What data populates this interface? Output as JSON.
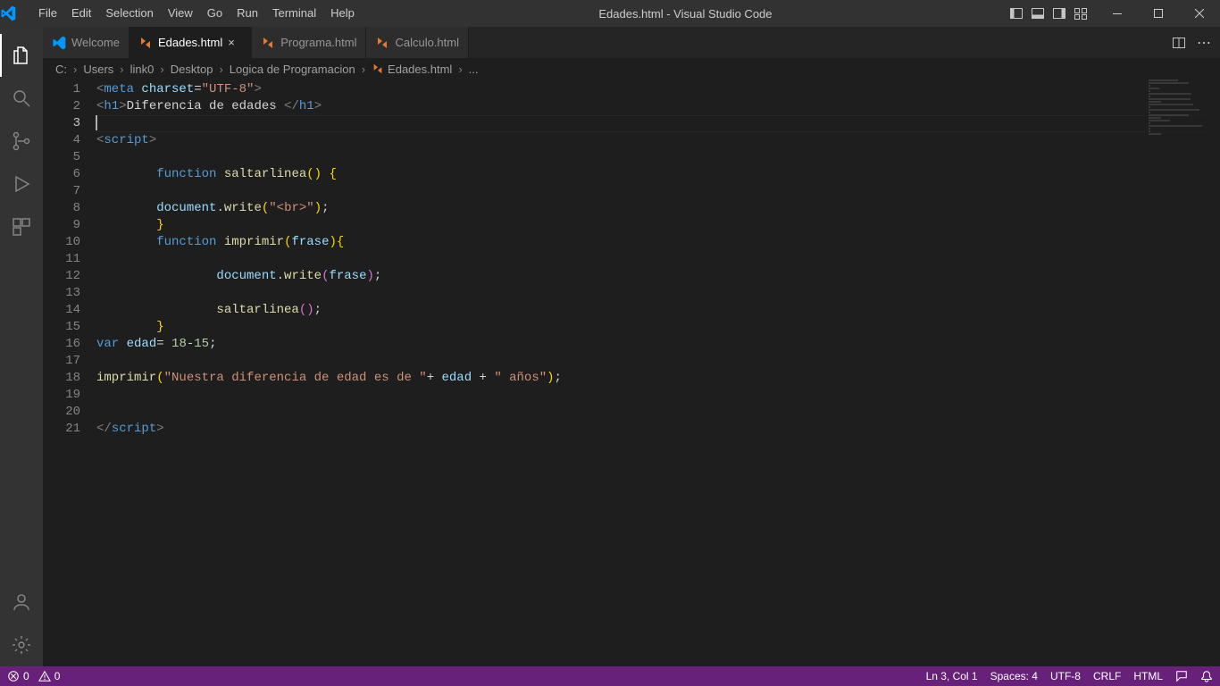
{
  "window": {
    "title": "Edades.html - Visual Studio Code"
  },
  "menu": [
    "File",
    "Edit",
    "Selection",
    "View",
    "Go",
    "Run",
    "Terminal",
    "Help"
  ],
  "tabs": [
    {
      "label": "Welcome",
      "icon": "vscode",
      "active": false
    },
    {
      "label": "Edades.html",
      "icon": "html",
      "active": true
    },
    {
      "label": "Programa.html",
      "icon": "html",
      "active": false
    },
    {
      "label": "Calculo.html",
      "icon": "html",
      "active": false
    }
  ],
  "breadcrumbs": {
    "segments": [
      "C:",
      "Users",
      "link0",
      "Desktop",
      "Logica de Programacion"
    ],
    "file": "Edades.html",
    "tail": "..."
  },
  "editor": {
    "line_count": 21,
    "active_line": 3,
    "lines": [
      {
        "tokens": [
          {
            "c": "c-punc",
            "t": "<"
          },
          {
            "c": "c-tag",
            "t": "meta"
          },
          {
            "c": "",
            "t": " "
          },
          {
            "c": "c-attr",
            "t": "charset"
          },
          {
            "c": "c-delim",
            "t": "="
          },
          {
            "c": "c-str",
            "t": "\"UTF-8\""
          },
          {
            "c": "c-punc",
            "t": ">"
          }
        ]
      },
      {
        "tokens": [
          {
            "c": "c-punc",
            "t": "<"
          },
          {
            "c": "c-tag",
            "t": "h1"
          },
          {
            "c": "c-punc",
            "t": ">"
          },
          {
            "c": "c-text",
            "t": "Diferencia de edades "
          },
          {
            "c": "c-punc",
            "t": "</"
          },
          {
            "c": "c-tag",
            "t": "h1"
          },
          {
            "c": "c-punc",
            "t": ">"
          }
        ]
      },
      {
        "tokens": [],
        "cursor": true
      },
      {
        "tokens": [
          {
            "c": "c-punc",
            "t": "<"
          },
          {
            "c": "c-tag",
            "t": "script"
          },
          {
            "c": "c-punc",
            "t": ">"
          }
        ]
      },
      {
        "tokens": []
      },
      {
        "indent": 2,
        "tokens": [
          {
            "c": "c-kw",
            "t": "function"
          },
          {
            "c": "",
            "t": " "
          },
          {
            "c": "c-fn",
            "t": "saltarlinea"
          },
          {
            "c": "c-brace",
            "t": "()"
          },
          {
            "c": "",
            "t": " "
          },
          {
            "c": "c-brace",
            "t": "{"
          }
        ]
      },
      {
        "tokens": []
      },
      {
        "indent": 2,
        "tokens": [
          {
            "c": "c-var",
            "t": "document"
          },
          {
            "c": "c-delim",
            "t": "."
          },
          {
            "c": "c-fn",
            "t": "write"
          },
          {
            "c": "c-brace",
            "t": "("
          },
          {
            "c": "c-str",
            "t": "\"<br>\""
          },
          {
            "c": "c-brace",
            "t": ")"
          },
          {
            "c": "c-delim",
            "t": ";"
          }
        ]
      },
      {
        "indent": 2,
        "tokens": [
          {
            "c": "c-brace",
            "t": "}"
          }
        ]
      },
      {
        "indent": 2,
        "tokens": [
          {
            "c": "c-kw",
            "t": "function"
          },
          {
            "c": "",
            "t": " "
          },
          {
            "c": "c-fn",
            "t": "imprimir"
          },
          {
            "c": "c-brace",
            "t": "("
          },
          {
            "c": "c-var",
            "t": "frase"
          },
          {
            "c": "c-brace",
            "t": ")"
          },
          {
            "c": "c-brace",
            "t": "{"
          }
        ]
      },
      {
        "tokens": []
      },
      {
        "indent": 4,
        "tokens": [
          {
            "c": "c-var",
            "t": "document"
          },
          {
            "c": "c-delim",
            "t": "."
          },
          {
            "c": "c-fn",
            "t": "write"
          },
          {
            "c": "c-brace2",
            "t": "("
          },
          {
            "c": "c-var",
            "t": "frase"
          },
          {
            "c": "c-brace2",
            "t": ")"
          },
          {
            "c": "c-delim",
            "t": ";"
          }
        ]
      },
      {
        "tokens": []
      },
      {
        "indent": 4,
        "tokens": [
          {
            "c": "c-fn",
            "t": "saltarlinea"
          },
          {
            "c": "c-brace2",
            "t": "()"
          },
          {
            "c": "c-delim",
            "t": ";"
          }
        ]
      },
      {
        "indent": 2,
        "tokens": [
          {
            "c": "c-brace",
            "t": "}"
          }
        ]
      },
      {
        "tokens": [
          {
            "c": "c-kw",
            "t": "var"
          },
          {
            "c": "",
            "t": " "
          },
          {
            "c": "c-var",
            "t": "edad"
          },
          {
            "c": "c-delim",
            "t": "= "
          },
          {
            "c": "c-num",
            "t": "18"
          },
          {
            "c": "c-delim",
            "t": "-"
          },
          {
            "c": "c-num",
            "t": "15"
          },
          {
            "c": "c-delim",
            "t": ";"
          }
        ]
      },
      {
        "tokens": []
      },
      {
        "tokens": [
          {
            "c": "c-fn",
            "t": "imprimir"
          },
          {
            "c": "c-brace",
            "t": "("
          },
          {
            "c": "c-str",
            "t": "\"Nuestra diferencia de edad es de \""
          },
          {
            "c": "c-delim",
            "t": "+ "
          },
          {
            "c": "c-var",
            "t": "edad"
          },
          {
            "c": "c-delim",
            "t": " + "
          },
          {
            "c": "c-str",
            "t": "\" años\""
          },
          {
            "c": "c-brace",
            "t": ")"
          },
          {
            "c": "c-delim",
            "t": ";"
          }
        ]
      },
      {
        "tokens": []
      },
      {
        "tokens": []
      },
      {
        "tokens": [
          {
            "c": "c-punc",
            "t": "</"
          },
          {
            "c": "c-tag",
            "t": "script"
          },
          {
            "c": "c-punc",
            "t": ">"
          }
        ]
      }
    ]
  },
  "status": {
    "errors": "0",
    "warnings": "0",
    "position": "Ln 3, Col 1",
    "spaces": "Spaces: 4",
    "encoding": "UTF-8",
    "eol": "CRLF",
    "lang": "HTML"
  }
}
